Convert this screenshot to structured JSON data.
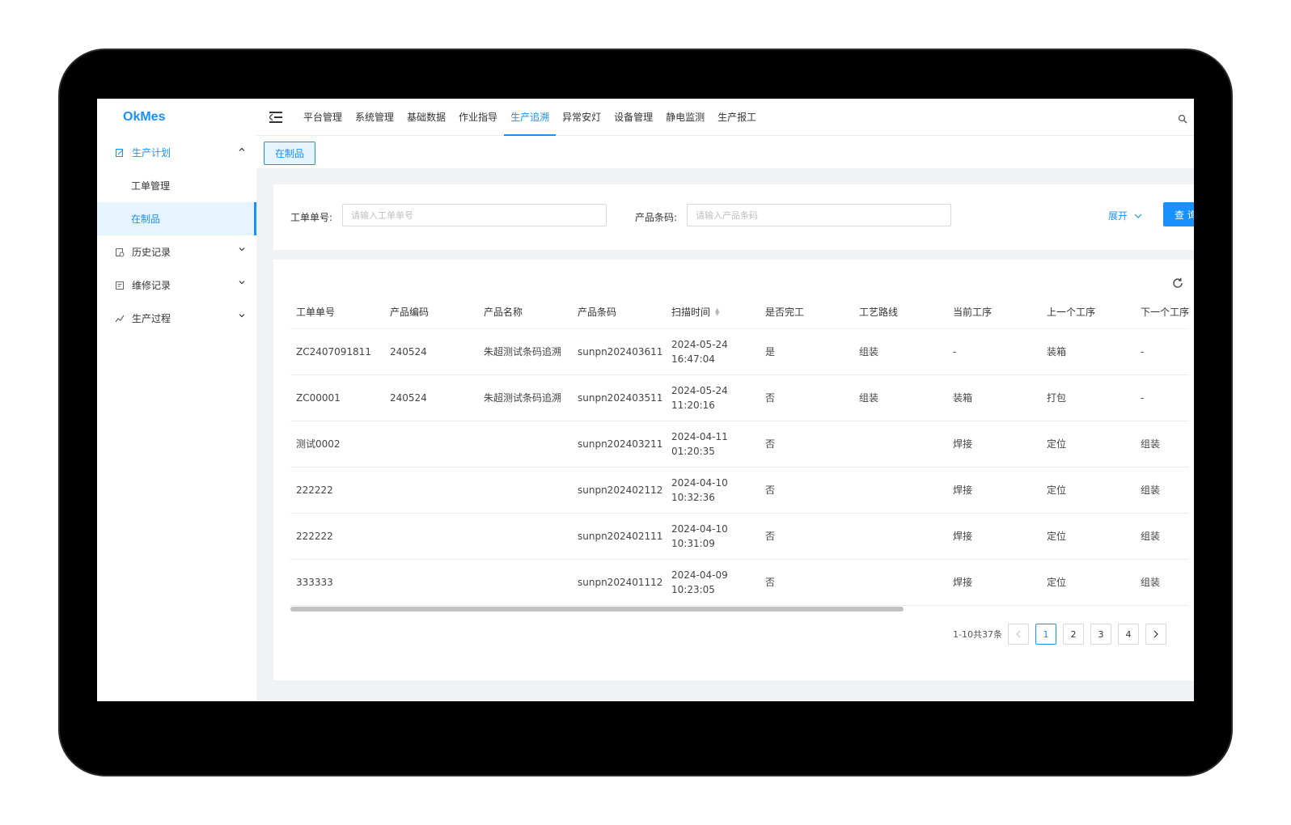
{
  "app": {
    "logo": "OkMes"
  },
  "sidebar": {
    "items": [
      {
        "label": "生产计划",
        "icon": "edit-doc-icon",
        "open": true,
        "children": [
          {
            "label": "工单管理"
          },
          {
            "label": "在制品",
            "active": true
          }
        ]
      },
      {
        "label": "历史记录",
        "icon": "history-doc-icon"
      },
      {
        "label": "维修记录",
        "icon": "repair-list-icon"
      },
      {
        "label": "生产过程",
        "icon": "line-chart-icon"
      }
    ]
  },
  "header": {
    "tabs": [
      {
        "label": "平台管理"
      },
      {
        "label": "系统管理"
      },
      {
        "label": "基础数据"
      },
      {
        "label": "作业指导"
      },
      {
        "label": "生产追溯",
        "active": true
      },
      {
        "label": "异常安灯"
      },
      {
        "label": "设备管理"
      },
      {
        "label": "静电监测"
      },
      {
        "label": "生产报工"
      }
    ]
  },
  "tagbar": {
    "active_tag": "在制品"
  },
  "search": {
    "order_label": "工单单号:",
    "order_placeholder": "请输入工单单号",
    "barcode_label": "产品条码:",
    "barcode_placeholder": "请输入产品条码",
    "expand_label": "展开",
    "query_label": "查 询"
  },
  "table": {
    "columns": [
      "工单单号",
      "产品编码",
      "产品名称",
      "产品条码",
      "扫描时间",
      "是否完工",
      "工艺路线",
      "当前工序",
      "上一个工序",
      "下一个工序"
    ],
    "rows": [
      {
        "order": "ZC2407091811",
        "code": "240524",
        "name": "朱超测试条码追溯",
        "barcode": "sunpn202403611",
        "date": "2024-05-24",
        "time": "16:47:04",
        "done": "是",
        "route": "组装",
        "current": "-",
        "prev": "装箱",
        "next": "-"
      },
      {
        "order": "ZC00001",
        "code": "240524",
        "name": "朱超测试条码追溯",
        "barcode": "sunpn202403511",
        "date": "2024-05-24",
        "time": "11:20:16",
        "done": "否",
        "route": "组装",
        "current": "装箱",
        "prev": "打包",
        "next": "-"
      },
      {
        "order": "测试0002",
        "code": "",
        "name": "",
        "barcode": "sunpn202403211",
        "date": "2024-04-11",
        "time": "01:20:35",
        "done": "否",
        "route": "",
        "current": "焊接",
        "prev": "定位",
        "next": "组装"
      },
      {
        "order": "222222",
        "code": "",
        "name": "",
        "barcode": "sunpn202402112",
        "date": "2024-04-10",
        "time": "10:32:36",
        "done": "否",
        "route": "",
        "current": "焊接",
        "prev": "定位",
        "next": "组装"
      },
      {
        "order": "222222",
        "code": "",
        "name": "",
        "barcode": "sunpn202402111",
        "date": "2024-04-10",
        "time": "10:31:09",
        "done": "否",
        "route": "",
        "current": "焊接",
        "prev": "定位",
        "next": "组装"
      },
      {
        "order": "333333",
        "code": "",
        "name": "",
        "barcode": "sunpn202401112",
        "date": "2024-04-09",
        "time": "10:23:05",
        "done": "否",
        "route": "",
        "current": "焊接",
        "prev": "定位",
        "next": "组装"
      }
    ]
  },
  "pagination": {
    "total_text": "1-10共37条",
    "pages": [
      "1",
      "2",
      "3",
      "4"
    ],
    "current": "1"
  },
  "colors": {
    "accent": "#1890ff",
    "active_bg": "#e6f4ff",
    "bg": "#f0f2f5"
  }
}
